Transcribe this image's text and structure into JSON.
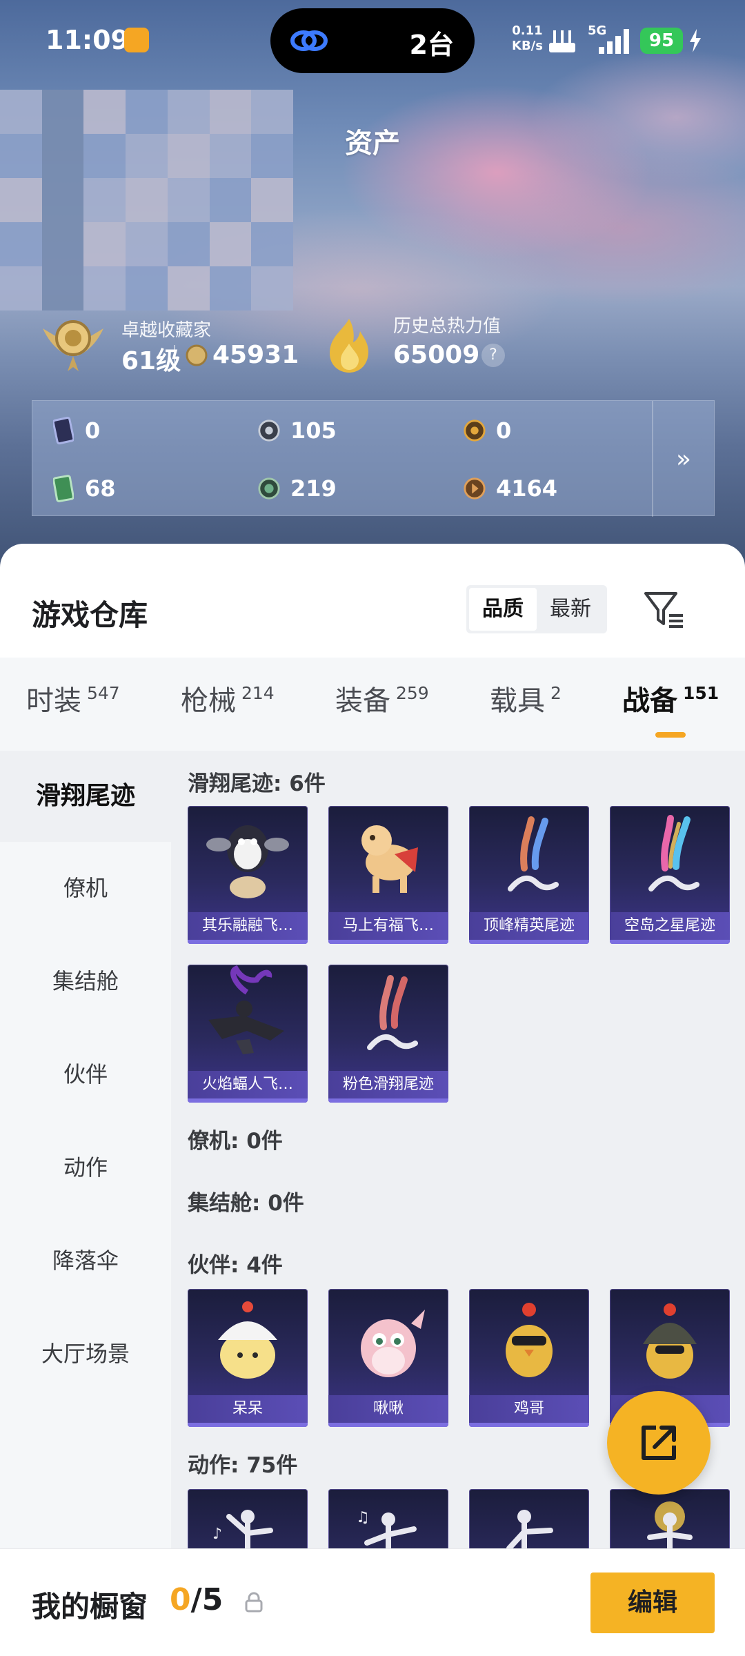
{
  "status_bar": {
    "time": "11:09",
    "island_label": "2台",
    "net_speed_value": "0.11",
    "net_speed_unit": "KB/s",
    "network": "5G",
    "battery": "95"
  },
  "header": {
    "title": "资产"
  },
  "collector": {
    "title": "卓越收藏家",
    "level": "61级",
    "points": "45931"
  },
  "heat": {
    "title": "历史总热力值",
    "value": "65009",
    "help": "?"
  },
  "currencies": [
    {
      "icon": "card-icon",
      "value": "0"
    },
    {
      "icon": "silver-coin-icon",
      "value": "105"
    },
    {
      "icon": "gold-token-icon",
      "value": "0"
    },
    {
      "icon": "green-ticket-icon",
      "value": "68"
    },
    {
      "icon": "green-coin-icon",
      "value": "219"
    },
    {
      "icon": "bronze-coin-icon",
      "value": "4164"
    }
  ],
  "currency_more": "»",
  "warehouse": {
    "title": "游戏仓库",
    "sort_options": [
      "品质",
      "最新"
    ],
    "active_sort": "品质"
  },
  "tabs": [
    {
      "label": "时装",
      "count": "547"
    },
    {
      "label": "枪械",
      "count": "214"
    },
    {
      "label": "装备",
      "count": "259"
    },
    {
      "label": "载具",
      "count": "2"
    },
    {
      "label": "战备",
      "count": "151"
    }
  ],
  "active_tab": "战备",
  "sidebar": [
    "滑翔尾迹",
    "僚机",
    "集结舱",
    "伙伴",
    "动作",
    "降落伞",
    "大厅场景"
  ],
  "active_sidebar": "滑翔尾迹",
  "sections": [
    {
      "title": "滑翔尾迹: 6件",
      "items": [
        "其乐融融飞…",
        "马上有福飞…",
        "顶峰精英尾迹",
        "空岛之星尾迹",
        "火焰蝠人飞…",
        "粉色滑翔尾迹"
      ]
    },
    {
      "title": "僚机: 0件",
      "items": []
    },
    {
      "title": "集结舱: 0件",
      "items": []
    },
    {
      "title": "伙伴: 4件",
      "items": [
        "呆呆",
        "啾啾",
        "鸡哥",
        ""
      ]
    },
    {
      "title": "动作: 75件",
      "items": []
    }
  ],
  "showcase": {
    "title": "我的橱窗",
    "used": "0",
    "total": "/5",
    "edit_label": "编辑"
  },
  "colors": {
    "accent": "#f5a623",
    "card_bg": "#2b2a5e",
    "card_label": "#5b4eb6"
  }
}
